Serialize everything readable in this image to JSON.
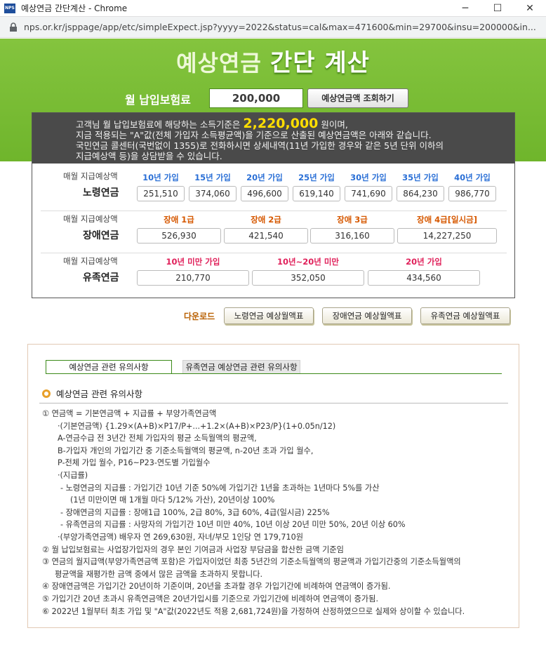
{
  "window": {
    "title": "예상연금 간단계산 - Chrome",
    "app_icon_text": "NPS"
  },
  "address": {
    "url": "nps.or.kr/jsppage/app/etc/simpleExpect.jsp?yyyy=2022&status=cal&max=471600&min=29700&insu=200000&in..."
  },
  "heading": {
    "part1": "예상연금",
    "part2": "간단 계산"
  },
  "premium": {
    "label": "월 납입보험료",
    "value": "200,000",
    "button": "예상연금액 조회하기"
  },
  "notice": {
    "line1_pre": "고객님 월 납입보험료에 해당하는 소득기준은",
    "amount": "2,220,000",
    "line1_post": "원이며,",
    "line2": "지금 적용되는 \"A\"값(전체 가입자 소득평균액)을 기준으로 산출된 예상연금액은 아래와 같습니다.",
    "line3": "국민연금 콜센터(국번없이 1355)로 전화하시면 상세내역(11년 가입한 경우와 같은 5년 단위 이하의",
    "line4": "지급예상액 등)을 상담받을 수 있습니다."
  },
  "old_age": {
    "sub": "매월 지급예상액",
    "name": "노령연금",
    "columns": [
      {
        "label": "10년 가입",
        "value": "251,510"
      },
      {
        "label": "15년 가입",
        "value": "374,060"
      },
      {
        "label": "20년 가입",
        "value": "496,600"
      },
      {
        "label": "25년 가입",
        "value": "619,140"
      },
      {
        "label": "30년 가입",
        "value": "741,690"
      },
      {
        "label": "35년 가입",
        "value": "864,230"
      },
      {
        "label": "40년 가입",
        "value": "986,770"
      }
    ]
  },
  "disability": {
    "sub": "매월 지급예상액",
    "name": "장애연금",
    "columns": [
      {
        "label": "장애 1급",
        "value": "526,930"
      },
      {
        "label": "장애 2급",
        "value": "421,540"
      },
      {
        "label": "장애 3급",
        "value": "316,160"
      },
      {
        "label": "장애 4급[일시금]",
        "value": "14,227,250"
      }
    ]
  },
  "survivor": {
    "sub": "매월 지급예상액",
    "name": "유족연금",
    "columns": [
      {
        "label": "10년 미만 가입",
        "value": "210,770"
      },
      {
        "label": "10년~20년 미만",
        "value": "352,050"
      },
      {
        "label": "20년 가입",
        "value": "434,560"
      }
    ]
  },
  "download": {
    "label": "다운로드",
    "buttons": [
      "노령연금 예상월액표",
      "장애연금 예상월액표",
      "유족연금 예상월액표"
    ]
  },
  "caution": {
    "tabs": [
      "예상연금 관련 유의사항",
      "유족연금 예상연금 관련 유의사항"
    ],
    "title": "예상연금 관련 유의사항",
    "lines": [
      "① 연금액 = 기본연금액 + 지급률 + 부양가족연금액",
      "·(기본연금액) {1.29×(A+B)×P17/P+...+1.2×(A+B)×P23/P}(1+0.05n/12)",
      "A-연금수급 전 3년간 전체 가입자의 평균 소득월액의 평균액,",
      "B-가입자 개인의 가입기간 중 기준소득월액의 평균액, n-20년 초과 가입 월수,",
      "P-전체 가입 월수, P16~P23-연도별 가입월수",
      "·(지급률)",
      "- 노령연금의 지급률 : 가입기간 10년 기준 50%에 가입기간 1년을 초과하는 1년마다 5%를 가산",
      "(1년 미만이면 매 1개월 마다 5/12% 가산), 20년이상 100%",
      "- 장애연금의 지급률 : 장애1급 100%, 2급 80%, 3급 60%, 4급(일시금) 225%",
      "- 유족연금의 지급률 : 사망자의 가입기간 10년 미만 40%, 10년 이상 20년 미만 50%, 20년 이상 60%",
      "·(부양가족연금액) 배우자 연 269,630원, 자녀/부모 1인당 연 179,710원",
      "② 월 납입보험료는 사업장가입자의 경우 본인 기여금과 사업장 부담금을 합산한 금액 기준임",
      "③ 연금의 월지급액(부양가족연금액 포함)은 가입자이었던 최종 5년간의 기준소득월액의 평균액과 가입기간중의 기준소득월액의",
      "평균액을 재평가한 금액 중에서 많은 금액을 초과하지 못합니다.",
      "④ 장애연금액은 가입기간 20년이하 기준이며, 20년을 초과할 경우 가입기간에 비례하여 연금액이 증가됨.",
      "⑤ 가입기간 20년 초과시 유족연금액은 20년가입시를 기준으로 가입기간에 비례하여 연금액이 증가됨.",
      "⑥ 2022년 1월부터 최초 가입 및 \"A\"값(2022년도 적용 2,681,724원)을 가정하여 산정하였으므로 실제와 상이할 수 있습니다."
    ]
  }
}
